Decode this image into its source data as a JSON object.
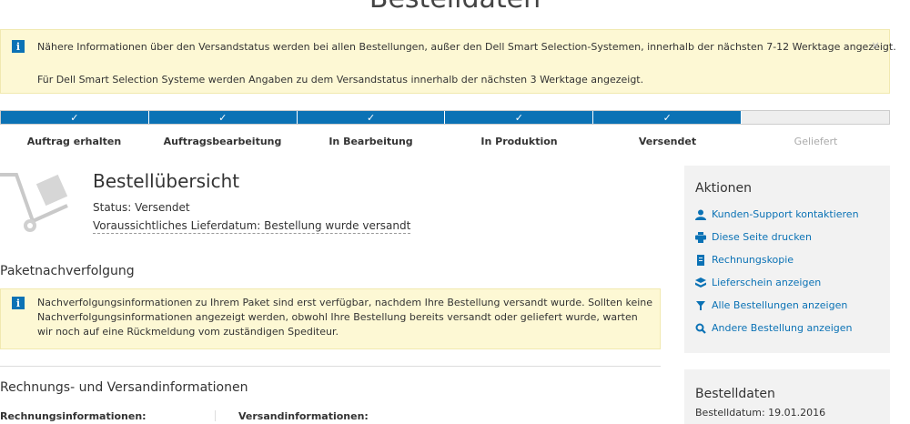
{
  "page": {
    "title": "Bestelldaten"
  },
  "top_alert": {
    "line1": "Nähere Informationen über den Versandstatus werden bei allen Bestellungen, außer den Dell Smart Selection-Systemen, innerhalb der nächsten 7-12 Werktage angezeigt.",
    "line2": "Für Dell Smart Selection Systeme werden Angaben zu dem Versandstatus innerhalb der nächsten 3 Werktage angezeigt.",
    "close": "×"
  },
  "progress": {
    "completed": 5,
    "total": 6,
    "check": "✓",
    "steps": [
      "Auftrag erhalten",
      "Auftragsbearbeitung",
      "In Bearbeitung",
      "In Produktion",
      "Versendet",
      "Geliefert"
    ]
  },
  "overview": {
    "title": "Bestellübersicht",
    "status": "Status: Versendet",
    "delivery": "Voraussichtliches Lieferdatum: Bestellung wurde versandt"
  },
  "tracking": {
    "title": "Paketnachverfolgung",
    "info": "Nachverfolgungsinformationen zu Ihrem Paket sind erst verfügbar, nachdem Ihre Bestellung versandt wurde. Sollten keine Nachverfolgungsinformationen angezeigt werden, obwohl Ihre Bestellung bereits versandt oder geliefert wurde, warten wir noch auf eine Rückmeldung vom zuständigen Spediteur."
  },
  "shipping": {
    "title": "Rechnungs- und Versandinformationen",
    "billing_label": "Rechnungsinformationen:",
    "shipping_label": "Versandinformationen:"
  },
  "actions": {
    "title": "Aktionen",
    "items": [
      {
        "label": "Kunden-Support kontaktieren",
        "icon": "user-icon"
      },
      {
        "label": "Diese Seite drucken",
        "icon": "print-icon"
      },
      {
        "label": "Rechnungskopie",
        "icon": "invoice-icon"
      },
      {
        "label": "Lieferschein anzeigen",
        "icon": "delivery-note-icon"
      },
      {
        "label": "Alle Bestellungen anzeigen",
        "icon": "list-icon"
      },
      {
        "label": "Andere Bestellung anzeigen",
        "icon": "search-icon"
      }
    ]
  },
  "order_data": {
    "title": "Bestelldaten",
    "date": "Bestelldatum: 19.01.2016"
  },
  "colors": {
    "accent": "#0b72b5",
    "alert_bg": "#fdf8d4",
    "panel_bg": "#f2f2f2"
  }
}
